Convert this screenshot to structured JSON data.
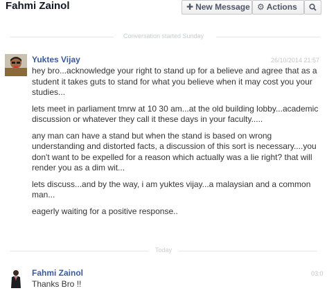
{
  "header": {
    "title": "Fahmi Zainol",
    "new_message_label": "New Message",
    "actions_label": "Actions"
  },
  "icons": {
    "new_message": "plus-icon",
    "actions": "gear-icon",
    "search": "search-icon"
  },
  "dividers": {
    "conversation_started": "Conversation started Sunday",
    "today": "Today"
  },
  "messages": [
    {
      "sender": "Yuktes Vijay",
      "time": "26/10/2014 21:57",
      "paragraphs": [
        "hey bro...acknowledge your right to stand up for a believe and agree that as a student it takes guts to stand for what you believe when it may cost you your studies...",
        "lets meet in parliament tmrw at 10 30 am...at the old building lobby...academic discussion or whatever they call it these days in your faculty.....",
        "any man can have a stand but when the stand is based on wrong understanding and distorted facts, a discussion of this sort is necessary....you don't want to be expelled for a reason which actually was a lie right? that will render you as a dim wit...",
        "lets discuss...and by the way, i am yuktes vijay...a malaysian and a common man...",
        "eagerly waiting for a positive response.."
      ]
    },
    {
      "sender": "Fahmi Zainol",
      "time": "03:0",
      "paragraphs": [
        "Thanks Bro !!"
      ]
    }
  ],
  "colors": {
    "sender_name": "#3b5998",
    "body_text": "#333333",
    "meta_text": "#c4c4c4"
  }
}
